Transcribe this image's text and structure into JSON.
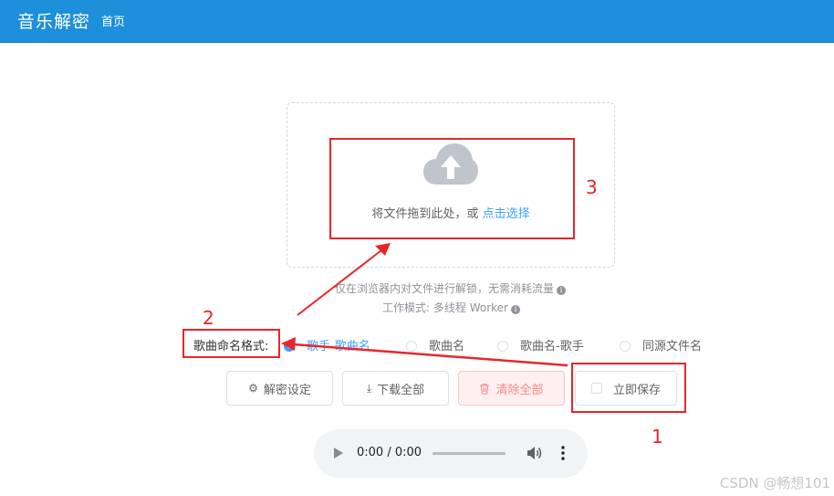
{
  "header": {
    "brand": "音乐解密",
    "nav_home": "首页"
  },
  "upload": {
    "prompt": "将文件拖到此处，或",
    "link": "点击选择",
    "icon": "upload-cloud-icon"
  },
  "hints": {
    "line1": "仅在浏览器内对文件进行解锁，无需消耗流量",
    "line2": "工作模式: 多线程 Worker"
  },
  "naming": {
    "label": "歌曲命名格式:",
    "options": [
      "歌手-歌曲名",
      "歌曲名",
      "歌曲名-歌手",
      "同源文件名"
    ],
    "selected": "歌手-歌曲名"
  },
  "actions": {
    "settings": "解密设定",
    "download_all": "下载全部",
    "clear_all": "清除全部",
    "save_now": "立即保存"
  },
  "player": {
    "time": "0:00 / 0:00",
    "progress": 0
  },
  "annotations": {
    "n1": "1",
    "n2": "2",
    "n3": "3",
    "color": "#e8262a"
  },
  "watermark": "CSDN @畅想101",
  "colors": {
    "header_bg": "#1d8fdb",
    "accent": "#409eff",
    "danger": "#f78989"
  }
}
